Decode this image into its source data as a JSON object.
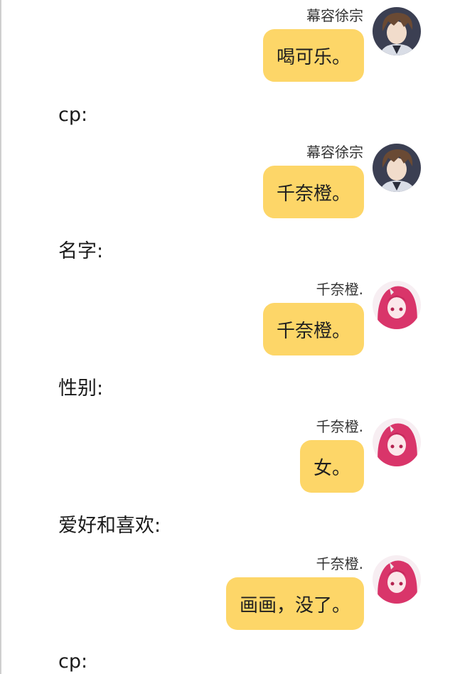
{
  "messages": [
    {
      "sender": "幕容徐宗",
      "text": "喝可乐。",
      "avatar": "boy-avatar"
    },
    {
      "sender": "幕容徐宗",
      "text": "千奈橙。",
      "avatar": "boy-avatar"
    },
    {
      "sender": "千奈橙.",
      "text": "千奈橙。",
      "avatar": "girl-avatar"
    },
    {
      "sender": "千奈橙.",
      "text": "女。",
      "avatar": "girl-avatar"
    },
    {
      "sender": "千奈橙.",
      "text": "画画，没了。",
      "avatar": "girl-avatar"
    }
  ],
  "prompts": [
    "cp:",
    "名字:",
    "性别:",
    "爱好和喜欢:",
    "cp:"
  ],
  "colors": {
    "bubble": "#fdd668",
    "background": "#ffffff"
  }
}
